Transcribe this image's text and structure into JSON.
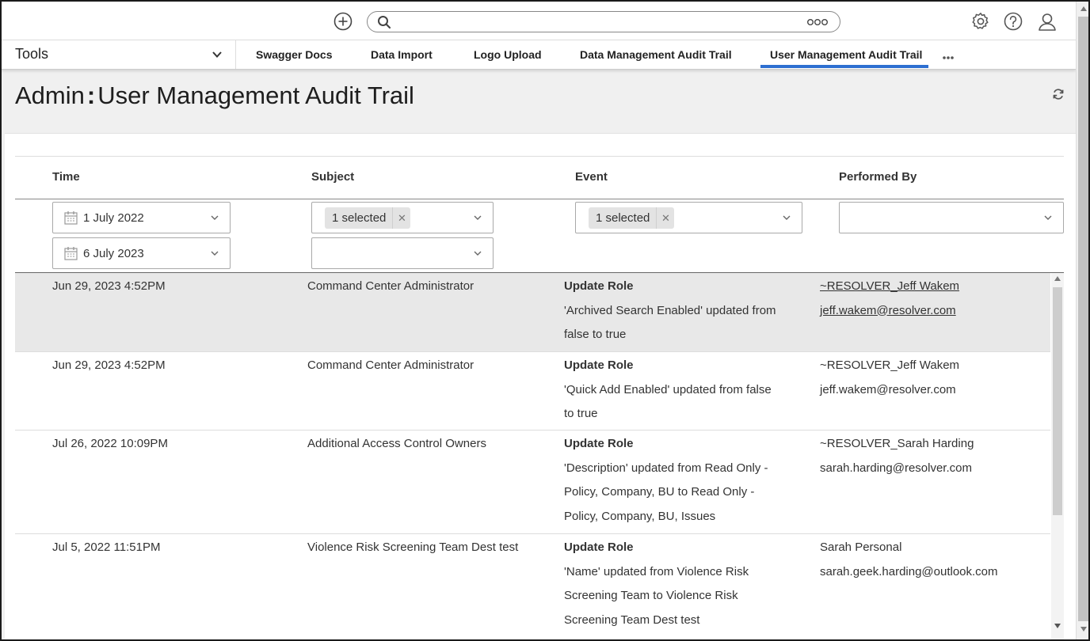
{
  "topbar": {
    "add_icon": "plus-circle-icon",
    "search_icon": "search-icon",
    "search_more_icon": "ellipsis-icon",
    "settings_icon": "gear-icon",
    "help_icon": "help-icon",
    "user_icon": "user-icon"
  },
  "nav": {
    "tools_label": "Tools",
    "tabs": [
      {
        "label": "Swagger Docs"
      },
      {
        "label": "Data Import"
      },
      {
        "label": "Logo Upload"
      },
      {
        "label": "Data Management Audit Trail"
      },
      {
        "label": "User Management Audit Trail",
        "active": true
      }
    ],
    "more_icon": "ellipsis-icon"
  },
  "page": {
    "title_prefix": "Admin",
    "title": "User Management Audit Trail",
    "refresh_icon": "refresh-icon"
  },
  "table": {
    "columns": [
      "Time",
      "Subject",
      "Event",
      "Performed By"
    ],
    "filters": {
      "time_from": "1 July 2022",
      "time_to": "6 July 2023",
      "subject_chip": "1 selected",
      "event_chip": "1 selected",
      "performed_by": ""
    },
    "rows": [
      {
        "time": "Jun 29, 2023 4:52PM",
        "subject": "Command Center Administrator",
        "event_title": "Update Role",
        "event_lines": [
          "'Archived Search Enabled' updated from",
          "false to true"
        ],
        "performer_name": "~RESOLVER_Jeff Wakem",
        "performer_email": "jeff.wakem@resolver.com",
        "highlighted": true
      },
      {
        "time": "Jun 29, 2023 4:52PM",
        "subject": "Command Center Administrator",
        "event_title": "Update Role",
        "event_lines": [
          "'Quick Add Enabled' updated from false",
          "to true"
        ],
        "performer_name": "~RESOLVER_Jeff Wakem",
        "performer_email": "jeff.wakem@resolver.com",
        "highlighted": false
      },
      {
        "time": "Jul 26, 2022 10:09PM",
        "subject": "Additional Access Control Owners",
        "event_title": "Update Role",
        "event_lines": [
          "'Description' updated from Read Only -",
          "Policy, Company, BU to Read Only -",
          "Policy, Company, BU, Issues"
        ],
        "performer_name": "~RESOLVER_Sarah Harding",
        "performer_email": "sarah.harding@resolver.com",
        "highlighted": false
      },
      {
        "time": "Jul 5, 2022 11:51PM",
        "subject": "Violence Risk Screening Team Dest test",
        "event_title": "Update Role",
        "event_lines": [
          "'Name' updated from Violence Risk",
          "Screening Team to Violence Risk",
          "Screening Team Dest test"
        ],
        "performer_name": "Sarah Personal",
        "performer_email": "sarah.geek.harding@outlook.com",
        "highlighted": false
      }
    ]
  }
}
